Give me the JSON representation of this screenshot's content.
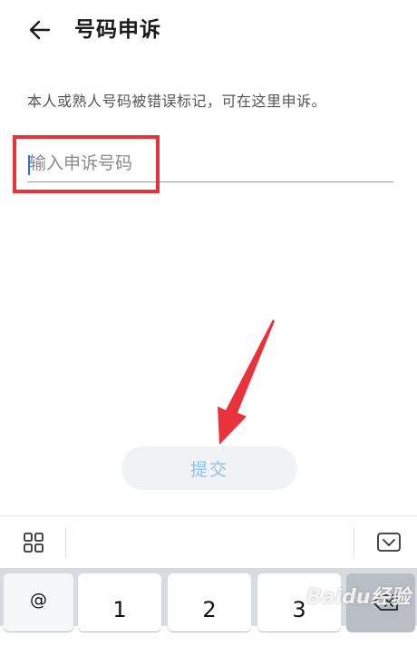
{
  "header": {
    "title": "号码申诉",
    "back_icon": "arrow-left-icon"
  },
  "hint": "本人或熟人号码被错误标记，可在这里申诉。",
  "input": {
    "placeholder": "输入申诉号码",
    "value": ""
  },
  "submit_label": "提交",
  "colors": {
    "annotation": "#e8333c",
    "submit_text": "#8ec0ef",
    "caret": "#2a6cf0"
  },
  "keyboard": {
    "toolbar_left_icon": "grid-icon",
    "toolbar_right_icon": "keyboard-collapse-icon",
    "keys": [
      {
        "label": "@"
      },
      {
        "label": "1"
      },
      {
        "label": "2"
      },
      {
        "label": "3"
      },
      {
        "icon": "backspace-icon"
      }
    ]
  },
  "watermark": "Baidu经验"
}
